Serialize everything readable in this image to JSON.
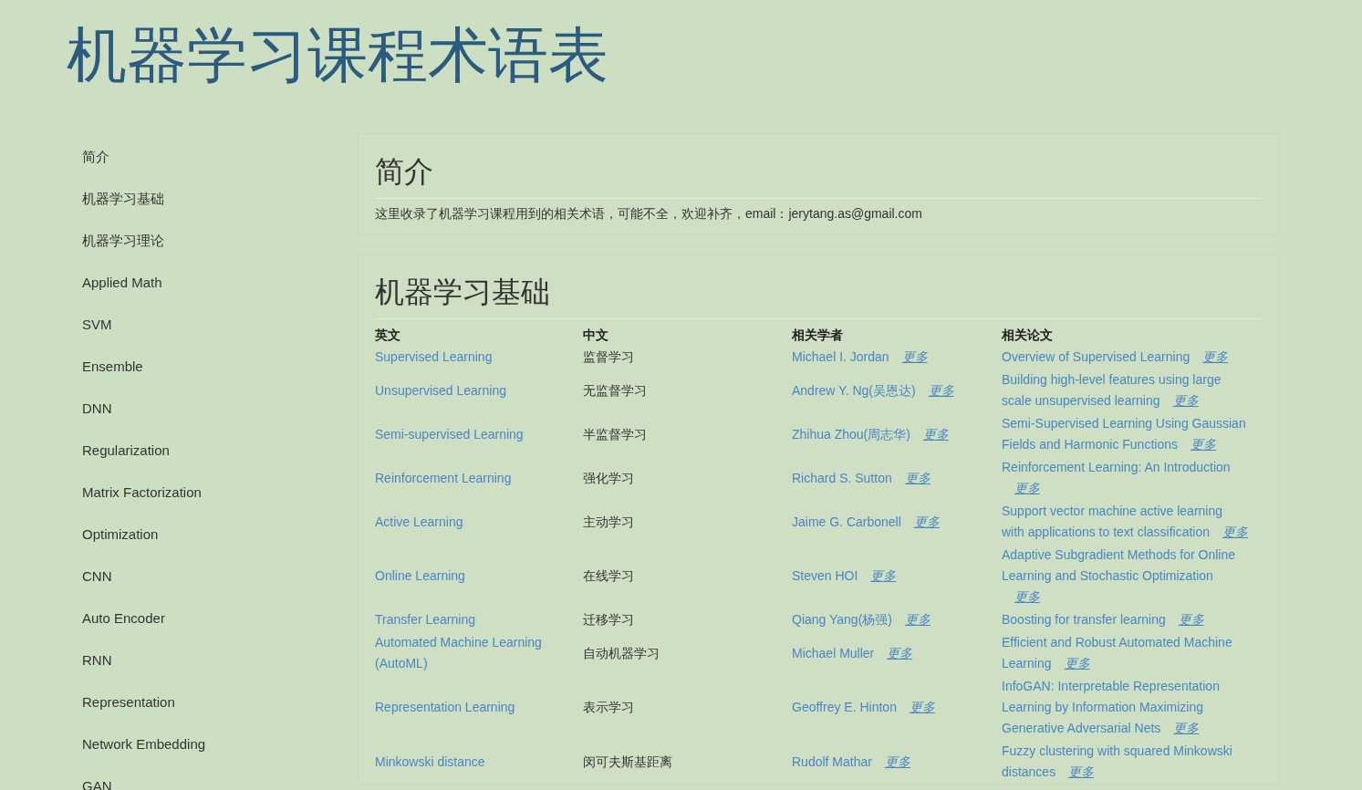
{
  "page_title": "机器学习课程术语表",
  "sidebar": {
    "items": [
      {
        "label": "简介"
      },
      {
        "label": "机器学习基础"
      },
      {
        "label": "机器学习理论"
      },
      {
        "label": "Applied Math"
      },
      {
        "label": "SVM"
      },
      {
        "label": "Ensemble"
      },
      {
        "label": "DNN"
      },
      {
        "label": "Regularization"
      },
      {
        "label": "Matrix Factorization"
      },
      {
        "label": "Optimization"
      },
      {
        "label": "CNN"
      },
      {
        "label": "Auto Encoder"
      },
      {
        "label": "RNN"
      },
      {
        "label": "Representation"
      },
      {
        "label": "Network Embedding"
      },
      {
        "label": "GAN"
      }
    ]
  },
  "intro": {
    "title": "简介",
    "text": "这里收录了机器学习课程用到的相关术语，可能不全，欢迎补齐，email：jerytang.as@gmail.com"
  },
  "basics": {
    "title": "机器学习基础",
    "columns": [
      "英文",
      "中文",
      "相关学者",
      "相关论文"
    ],
    "rows": [
      {
        "english": "Supervised Learning",
        "chinese": "监督学习",
        "scholar": "Michael I. Jordan",
        "scholar_more": "更多",
        "paper": "Overview of Supervised Learning",
        "paper_more": "更多"
      },
      {
        "english": "Unsupervised Learning",
        "chinese": "无监督学习",
        "scholar": "Andrew Y. Ng(吴恩达)",
        "scholar_more": "更多",
        "paper": "Building high-level features using large scale unsupervised learning",
        "paper_more": "更多"
      },
      {
        "english": "Semi-supervised Learning",
        "chinese": "半监督学习",
        "scholar": "Zhihua Zhou(周志华)",
        "scholar_more": "更多",
        "paper": "Semi-Supervised Learning Using Gaussian Fields and Harmonic Functions",
        "paper_more": "更多"
      },
      {
        "english": "Reinforcement Learning",
        "chinese": "强化学习",
        "scholar": "Richard S. Sutton",
        "scholar_more": "更多",
        "paper": "Reinforcement Learning: An Introduction",
        "paper_more": "更多"
      },
      {
        "english": "Active Learning",
        "chinese": "主动学习",
        "scholar": "Jaime G. Carbonell",
        "scholar_more": "更多",
        "paper": "Support vector machine active learning with applications to text classification",
        "paper_more": "更多"
      },
      {
        "english": "Online Learning",
        "chinese": "在线学习",
        "scholar": "Steven HOI",
        "scholar_more": "更多",
        "paper": "Adaptive Subgradient Methods for Online Learning and Stochastic Optimization",
        "paper_more": "更多"
      },
      {
        "english": "Transfer Learning",
        "chinese": "迁移学习",
        "scholar": "Qiang Yang(杨强)",
        "scholar_more": "更多",
        "paper": "Boosting for transfer learning",
        "paper_more": "更多"
      },
      {
        "english": "Automated Machine Learning (AutoML)",
        "chinese": "自动机器学习",
        "scholar": "Michael Muller",
        "scholar_more": "更多",
        "paper": "Efficient and Robust Automated Machine Learning",
        "paper_more": "更多"
      },
      {
        "english": "Representation Learning",
        "chinese": "表示学习",
        "scholar": "Geoffrey E. Hinton",
        "scholar_more": "更多",
        "paper": "InfoGAN: Interpretable Representation Learning by Information Maximizing Generative Adversarial Nets",
        "paper_more": "更多"
      },
      {
        "english": "Minkowski distance",
        "chinese": "闵可夫斯基距离",
        "scholar": "Rudolf Mathar",
        "scholar_more": "更多",
        "paper": "Fuzzy clustering with squared Minkowski distances",
        "paper_more": "更多"
      }
    ]
  }
}
